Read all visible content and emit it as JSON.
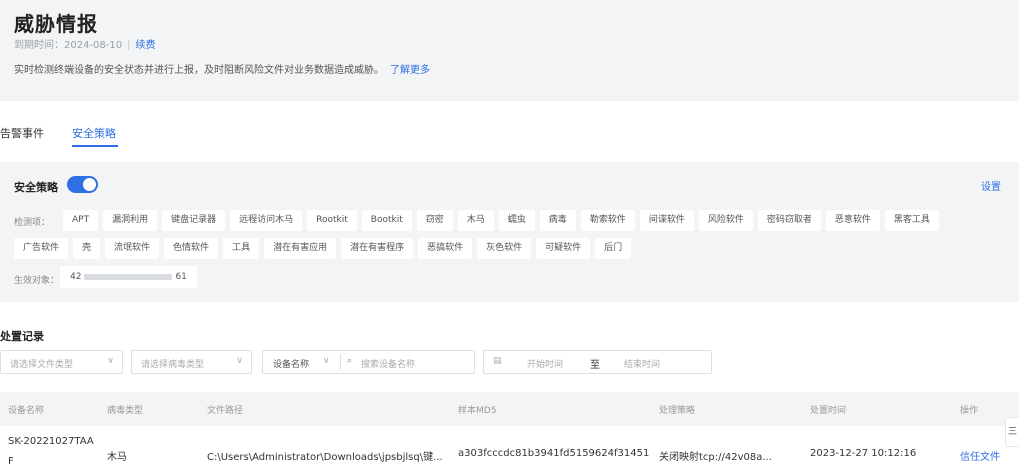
{
  "header": {
    "title": "威胁情报",
    "expire_label": "到期时间：2024-08-10",
    "separator": "|",
    "renew": "续费",
    "description": "实时检测终端设备的安全状态并进行上报，及时阻断风险文件对业务数据造成威胁。",
    "learn_more": "了解更多"
  },
  "tabs": [
    {
      "label": "告警事件",
      "active": false
    },
    {
      "label": "安全策略",
      "active": true
    }
  ],
  "policy": {
    "title": "安全策略",
    "enabled": true,
    "settings": "设置",
    "detect_label": "检测项：",
    "tags_row1": [
      "APT",
      "漏洞利用",
      "键盘记录器",
      "远程访问木马",
      "Rootkit",
      "Bootkit",
      "窃密",
      "木马",
      "蠕虫",
      "病毒",
      "勒索软件",
      "间谍软件",
      "风险软件",
      "密码窃取者",
      "恶意软件",
      "黑客工具"
    ],
    "tags_row2": [
      "广告软件",
      "壳",
      "流氓软件",
      "色情软件",
      "工具",
      "潜在有害应用",
      "潜在有害程序",
      "恶搞软件",
      "灰色软件",
      "可疑软件",
      "后门"
    ],
    "target_label": "生效对象：",
    "target_prefix": "42",
    "target_suffix": "61"
  },
  "records": {
    "title": "处置记录",
    "file_type_placeholder": "请选择文件类型",
    "virus_type_placeholder": "请选择病毒类型",
    "device_field": "设备名称",
    "search_placeholder": "搜索设备名称",
    "start_placeholder": "开始时间",
    "to": "至",
    "end_placeholder": "结束时间",
    "columns": [
      "设备名称",
      "病毒类型",
      "文件路径",
      "样本MD5",
      "处理策略",
      "处置时间",
      "操作"
    ],
    "rows": [
      {
        "device_line1": "SK-20221027TAA",
        "device_line2": "F",
        "virus_type": "木马",
        "file_path": "C:\\Users\\Administrator\\Downloads\\jpsbjlsq\\键...",
        "md5": "a303fcccdc81b3941fd5159624f31451",
        "policy": "关闭映射tcp://42v08a...",
        "time": "2023-12-27 10:12:16",
        "action": "信任文件"
      }
    ]
  },
  "float_tab": "三"
}
